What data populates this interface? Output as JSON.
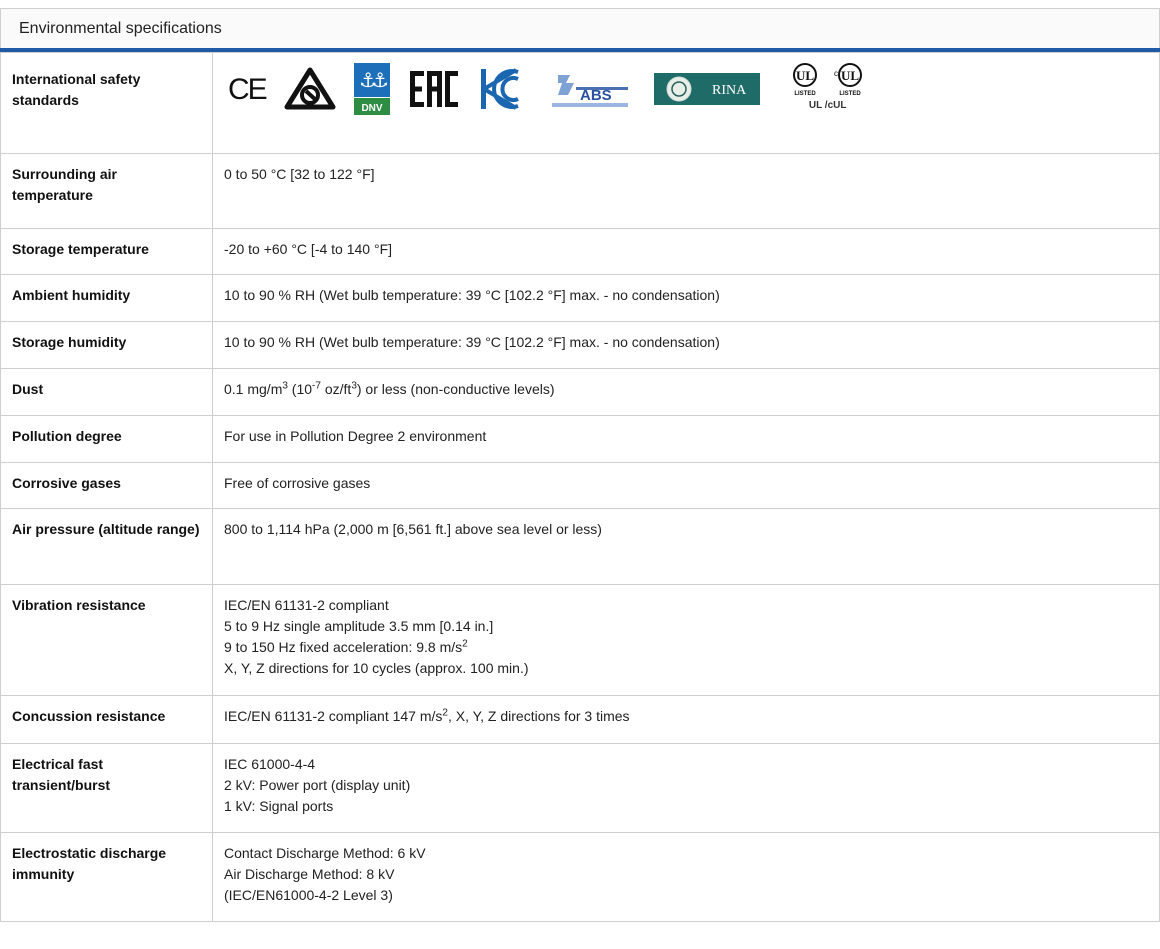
{
  "header": {
    "title": "Environmental specifications"
  },
  "logos": {
    "ce": "CE",
    "dnv": "DNV",
    "eac": "EAC",
    "abs": "ABS",
    "rina": "RINA",
    "ul_mark": "UL",
    "ul_listed": "LISTED",
    "ul_c": "c",
    "ul_caption": "UL /cUL"
  },
  "rows": [
    {
      "label": "International safety standards"
    },
    {
      "label": "Surrounding air temperature",
      "value": "0 to 50 °C [32 to 122 °F]"
    },
    {
      "label": "Storage temperature",
      "value": "-20 to +60 °C [-4 to 140 °F]"
    },
    {
      "label": "Ambient humidity",
      "value": "10 to 90 % RH (Wet bulb temperature: 39 °C [102.2 °F] max. - no condensation)"
    },
    {
      "label": "Storage humidity",
      "value": "10 to 90 % RH (Wet bulb temperature: 39 °C [102.2 °F] max. - no condensation)"
    },
    {
      "label": "Dust",
      "v1": "0.1 mg/m",
      "s1": "3",
      "v2": " (10",
      "s2": "-7",
      "v3": " oz/ft",
      "s3": "3",
      "v4": ") or less (non-conductive levels)"
    },
    {
      "label": "Pollution degree",
      "value": "For use in Pollution Degree 2 environment"
    },
    {
      "label": "Corrosive gases",
      "value": "Free of corrosive gases"
    },
    {
      "label": "Air pressure (altitude range)",
      "value": "800 to 1,114 hPa (2,000 m [6,561 ft.] above sea level or less)"
    },
    {
      "label": "Vibration resistance",
      "line1": "IEC/EN 61131-2 compliant",
      "line2": "5 to 9 Hz single amplitude 3.5 mm [0.14 in.]",
      "line3a": "9 to 150 Hz fixed acceleration: 9.8 m/s",
      "line3sup": "2",
      "line4": "X, Y, Z directions for 10 cycles (approx. 100 min.)"
    },
    {
      "label": "Concussion resistance",
      "va": "IEC/EN 61131-2 compliant 147 m/s",
      "vsup": "2",
      "vb": ", X, Y, Z directions for 3 times"
    },
    {
      "label": "Electrical fast transient/burst",
      "line1": "IEC 61000-4-4",
      "line2": "2 kV: Power port (display unit)",
      "line3": "1 kV: Signal ports"
    },
    {
      "label": "Electrostatic discharge immunity",
      "line1": "Contact Discharge Method: 6 kV",
      "line2": "Air Discharge Method: 8 kV",
      "line3": "(IEC/EN61000-4-2 Level 3)"
    }
  ]
}
